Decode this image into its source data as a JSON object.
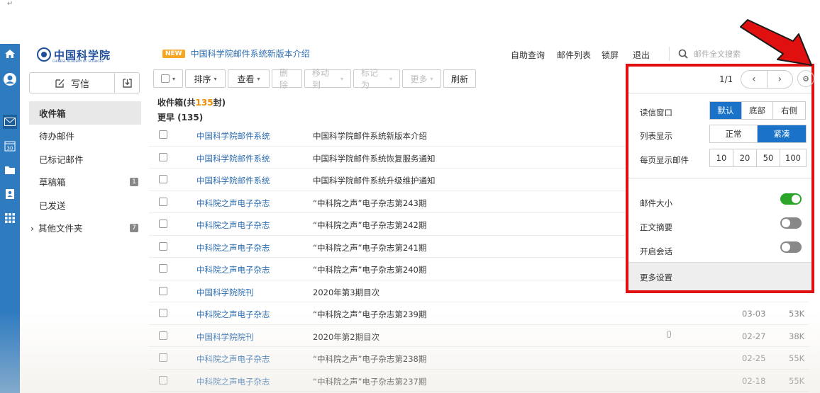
{
  "corner_mark": "↵",
  "brand": {
    "logo_text": "中国科学院",
    "logo_sub": "CHINESE ACADEMY OF SCIENCES"
  },
  "announcement": {
    "badge": "NEW",
    "text": "中国科学院邮件系统新版本介绍"
  },
  "topnav": {
    "items": [
      "自助查询",
      "邮件列表",
      "锁屏",
      "退出"
    ],
    "search_placeholder": "邮件全文搜索"
  },
  "sidebar": {
    "compose_label": "写信",
    "folders": [
      {
        "label": "收件箱",
        "count": ""
      },
      {
        "label": "待办邮件",
        "count": ""
      },
      {
        "label": "已标记邮件",
        "count": ""
      },
      {
        "label": "草稿箱",
        "count": "1"
      },
      {
        "label": "已发送",
        "count": ""
      },
      {
        "label": "其他文件夹",
        "count": "7",
        "prefix": "›"
      }
    ]
  },
  "toolbar": {
    "sort": "排序",
    "view": "查看",
    "delete": "删除",
    "move": "移动到",
    "mark": "标记为",
    "more": "更多",
    "refresh": "刷新"
  },
  "inbox": {
    "title_prefix": "收件箱(共",
    "total": "135",
    "title_suffix": "封)",
    "group_label": "更早 (135)"
  },
  "mails": [
    {
      "from": "中国科学院邮件系统",
      "subject": "中国科学院邮件系统新版本介绍",
      "date": "",
      "size": "",
      "attachment": false
    },
    {
      "from": "中国科学院邮件系统",
      "subject": "中国科学院邮件系统恢复服务通知",
      "date": "",
      "size": "",
      "attachment": false
    },
    {
      "from": "中国科学院邮件系统",
      "subject": "中国科学院邮件系统升级维护通知",
      "date": "",
      "size": "",
      "attachment": false
    },
    {
      "from": "中科院之声电子杂志",
      "subject": "“中科院之声”电子杂志第243期",
      "date": "",
      "size": "",
      "attachment": false
    },
    {
      "from": "中科院之声电子杂志",
      "subject": "“中科院之声”电子杂志第242期",
      "date": "",
      "size": "",
      "attachment": false
    },
    {
      "from": "中科院之声电子杂志",
      "subject": "“中科院之声”电子杂志第241期",
      "date": "",
      "size": "",
      "attachment": false
    },
    {
      "from": "中科院之声电子杂志",
      "subject": "“中科院之声”电子杂志第240期",
      "date": "",
      "size": "",
      "attachment": false
    },
    {
      "from": "中国科学院院刊",
      "subject": "2020年第3期目次",
      "date": "",
      "size": "",
      "attachment": false
    },
    {
      "from": "中科院之声电子杂志",
      "subject": "“中科院之声”电子杂志第239期",
      "date": "03-03",
      "size": "53K",
      "attachment": false
    },
    {
      "from": "中国科学院院刊",
      "subject": "2020年第2期目次",
      "date": "02-27",
      "size": "38K",
      "attachment": true
    },
    {
      "from": "中科院之声电子杂志",
      "subject": "“中科院之声”电子杂志第238期",
      "date": "02-25",
      "size": "55K",
      "attachment": false
    },
    {
      "from": "中科院之声电子杂志",
      "subject": "“中科院之声”电子杂志第237期",
      "date": "02-18",
      "size": "55K",
      "attachment": false
    }
  ],
  "settings": {
    "page_indicator": "1/1",
    "reading_pane_label": "读信窗口",
    "reading_pane_options": [
      "默认",
      "底部",
      "右侧"
    ],
    "reading_pane_selected": "默认",
    "list_display_label": "列表显示",
    "list_display_options": [
      "正常",
      "紧凑"
    ],
    "list_display_selected": "紧凑",
    "per_page_label": "每页显示邮件",
    "per_page_options": [
      "10",
      "20",
      "50",
      "100"
    ],
    "toggles": [
      {
        "label": "邮件大小",
        "on": true
      },
      {
        "label": "正文摘要",
        "on": false
      },
      {
        "label": "开启会话",
        "on": false
      }
    ],
    "more_settings": "更多设置"
  },
  "colors": {
    "rail": "#2f7bc0",
    "accent": "#1a73c8",
    "link": "#2b6cb0",
    "highlight_border": "#e01010",
    "toggle_on": "#2aa52a"
  }
}
